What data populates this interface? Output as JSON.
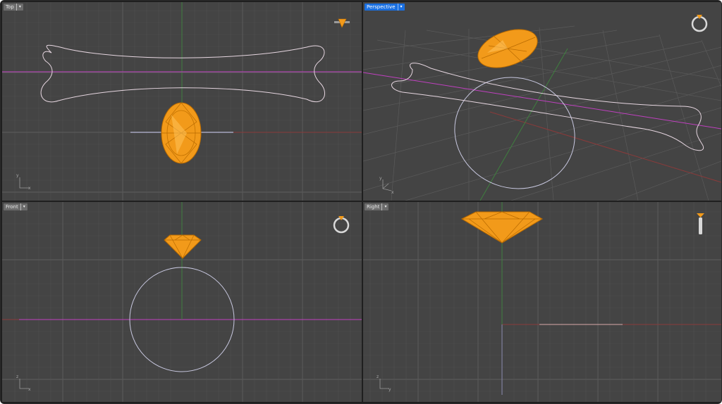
{
  "viewports": {
    "top": {
      "label": "Top",
      "menu_glyph": "▾",
      "axis_x": "x",
      "axis_y": "y",
      "active": false
    },
    "perspective": {
      "label": "Perspective",
      "menu_glyph": "▾",
      "axis_x": "x",
      "axis_y": "y",
      "active": true
    },
    "front": {
      "label": "Front",
      "menu_glyph": "▾",
      "axis_x": "x",
      "axis_y": "z",
      "active": false
    },
    "right": {
      "label": "Right",
      "menu_glyph": "▾",
      "axis_x": "y",
      "axis_y": "z",
      "active": false
    }
  },
  "colors": {
    "viewport_bg": "#444444",
    "grid_minor": "#4f4f4f",
    "grid_major": "#5c5c5c",
    "axis_x": "#8a3a3a",
    "axis_y": "#3f7f3f",
    "axis_z": "#8a8ab0",
    "curve": "#e6d6e0",
    "circle": "#c8c8e0",
    "magenta": "#c040c0",
    "gem_fill": "#f29a1a",
    "gem_light": "#ffc25a",
    "gem_edge": "#b86a00",
    "active_label": "#1a6fe0"
  },
  "icons": {
    "top": "ring-top-view-icon",
    "perspective": "ring-perspective-icon",
    "front": "ring-front-view-icon",
    "right": "ring-side-view-icon"
  }
}
